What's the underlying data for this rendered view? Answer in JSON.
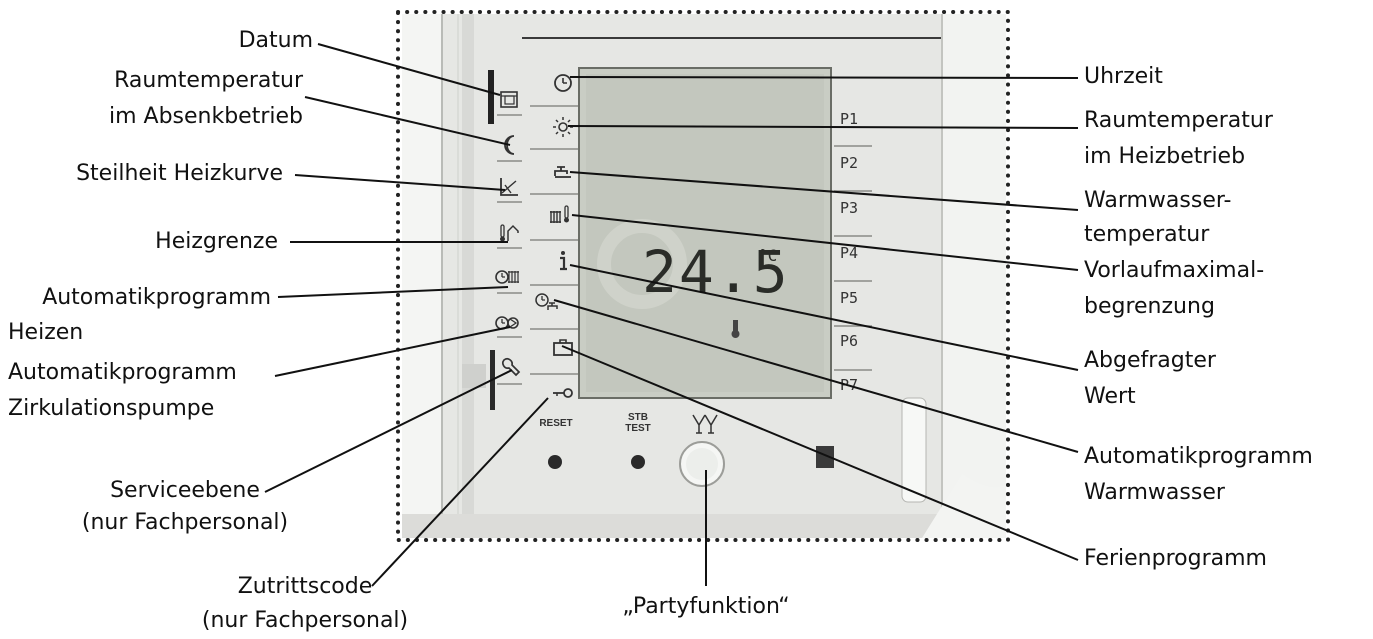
{
  "labels_left": {
    "datum": "Datum",
    "raumtemp_absenk_1": "Raumtemperatur",
    "raumtemp_absenk_2": "im Absenkbetrieb",
    "steilheit": "Steilheit Heizkurve",
    "heizgrenze": "Heizgrenze",
    "auto_heizen_1": "Automatikprogramm",
    "auto_heizen_2": "Heizen",
    "auto_zirk_1": "Automatikprogramm",
    "auto_zirk_2": "Zirkulationspumpe",
    "service_1": "Serviceebene",
    "service_2": "(nur Fachpersonal)",
    "zutritt_1": "Zutrittscode",
    "zutritt_2": "(nur Fachpersonal)"
  },
  "labels_right": {
    "uhrzeit": "Uhrzeit",
    "raumtemp_heiz_1": "Raumtemperatur",
    "raumtemp_heiz_2": "im Heizbetrieb",
    "warmwasser_1": "Warmwasser-",
    "warmwasser_2": "temperatur",
    "vorlauf_1": "Vorlaufmaximal-",
    "vorlauf_2": "begrenzung",
    "abgefragt_1": "Abgefragter",
    "abgefragt_2": "Wert",
    "auto_ww_1": "Automatikprogramm",
    "auto_ww_2": "Warmwasser",
    "ferien": "Ferienprogramm"
  },
  "label_bottom": {
    "party": "„Partyfunktion“"
  },
  "device": {
    "display_value": "24.5",
    "display_unit": "°C",
    "p_labels": [
      "P1",
      "P2",
      "P3",
      "P4",
      "P5",
      "P6",
      "P7"
    ],
    "reset_label": "RESET",
    "stb_label_1": "STB",
    "stb_label_2": "TEST",
    "icons": [
      "clock-icon",
      "sun-icon",
      "tap-icon",
      "radiator-thermometer-icon",
      "info-icon",
      "clock-tap-icon",
      "suitcase-icon",
      "calendar-icon",
      "moon-icon",
      "heating-curve-icon",
      "heating-limit-icon",
      "clock-radiator-icon",
      "clock-pump-icon",
      "wrench-icon",
      "key-icon",
      "party-glasses-icon"
    ]
  }
}
